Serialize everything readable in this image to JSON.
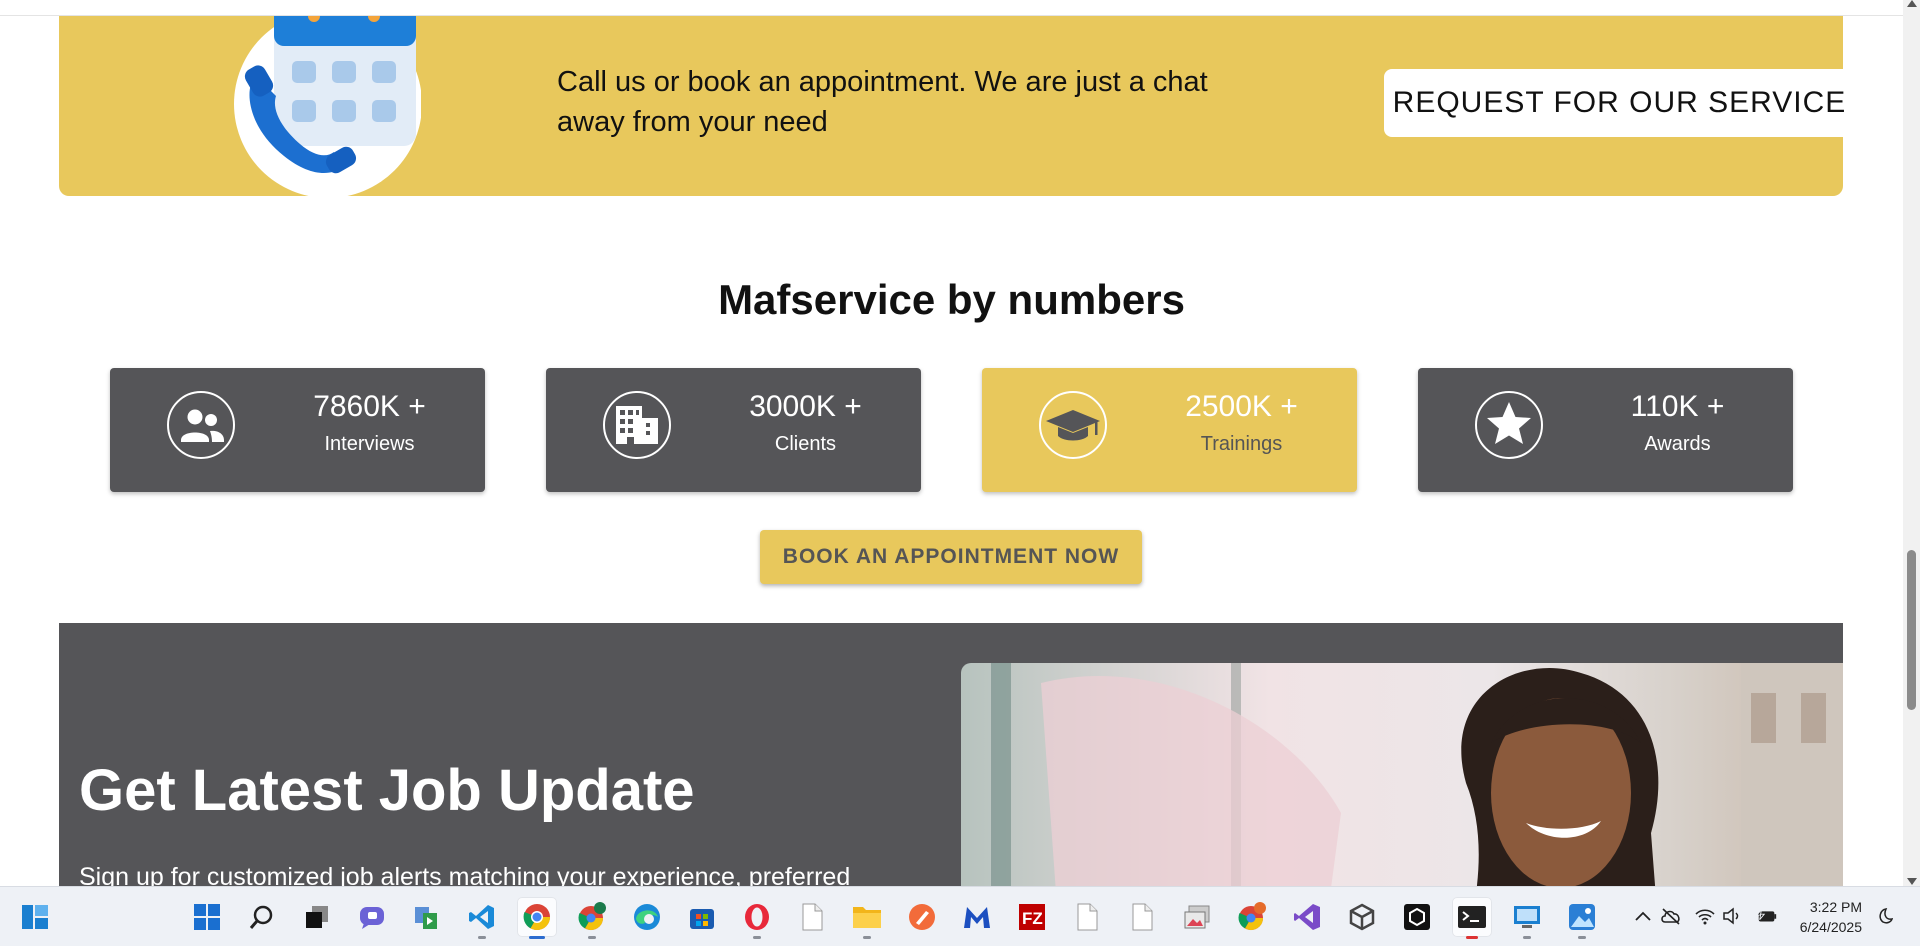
{
  "cta": {
    "text": "Call us or book an appointment. We are just a chat away from your need",
    "button_label": "REQUEST FOR OUR SERVICE"
  },
  "numbers": {
    "title": "Mafservice by numbers",
    "stats": [
      {
        "value": "7860K +",
        "label": "Interviews",
        "icon": "people-icon"
      },
      {
        "value": "3000K +",
        "label": "Clients",
        "icon": "building-icon"
      },
      {
        "value": "2500K +",
        "label": "Trainings",
        "icon": "graduation-cap-icon"
      },
      {
        "value": "110K +",
        "label": "Awards",
        "icon": "star-icon"
      }
    ],
    "book_button_label": "BOOK AN APPOINTMENT NOW"
  },
  "job_update": {
    "title": "Get Latest Job Update",
    "text": "Sign up for customized job alerts matching your experience, preferred"
  },
  "taskbar": {
    "apps": [
      "widgets",
      "start",
      "search",
      "task-view",
      "teams",
      "file-transfer",
      "vscode",
      "chrome",
      "chrome-profile",
      "edge",
      "store",
      "opera",
      "file",
      "file-explorer",
      "postman",
      "malwarebytes",
      "filezilla",
      "file",
      "file",
      "photos",
      "chrome-canary",
      "visual-studio",
      "unity",
      "unity-hub",
      "terminal",
      "rdp",
      "photos-app"
    ],
    "time": "3:22 PM",
    "date": "6/24/2025"
  },
  "colors": {
    "accent": "#e8c85c",
    "dark": "#555558"
  }
}
